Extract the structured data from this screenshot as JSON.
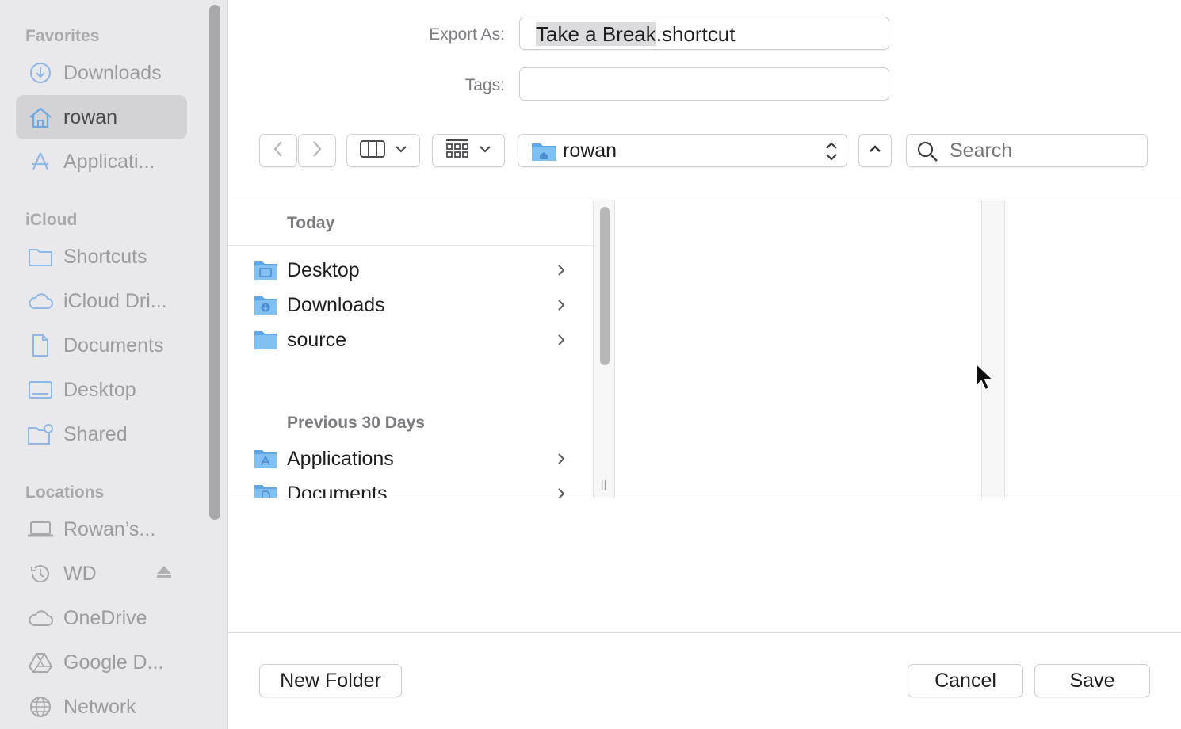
{
  "sidebar": {
    "sections": {
      "favorites": "Favorites",
      "icloud": "iCloud",
      "locations": "Locations"
    },
    "favorites": [
      {
        "label": "Downloads",
        "icon": "download-circle-icon"
      },
      {
        "label": "rowan",
        "icon": "home-icon",
        "selected": true
      },
      {
        "label": "Applicati...",
        "icon": "applications-icon"
      }
    ],
    "icloud": [
      {
        "label": "Shortcuts",
        "icon": "folder-icon"
      },
      {
        "label": "iCloud Dri...",
        "icon": "cloud-icon"
      },
      {
        "label": "Documents",
        "icon": "document-icon"
      },
      {
        "label": "Desktop",
        "icon": "desktop-icon"
      },
      {
        "label": "Shared",
        "icon": "shared-folder-icon"
      }
    ],
    "locations": [
      {
        "label": "Rowan’s...",
        "icon": "laptop-icon"
      },
      {
        "label": "WD",
        "icon": "time-machine-icon",
        "eject": true
      },
      {
        "label": "OneDrive",
        "icon": "cloud-icon"
      },
      {
        "label": "Google D...",
        "icon": "google-drive-icon"
      },
      {
        "label": "Network",
        "icon": "globe-icon"
      }
    ]
  },
  "form": {
    "export_label": "Export As:",
    "filename_base": "Take a Break",
    "filename_ext": ".shortcut",
    "tags_label": "Tags:",
    "tags_value": ""
  },
  "toolbar": {
    "location": "rowan",
    "search_placeholder": "Search"
  },
  "browser": {
    "groups": [
      {
        "title": "Today",
        "items": [
          {
            "name": "Desktop",
            "icon": "desktop-folder-icon"
          },
          {
            "name": "Downloads",
            "icon": "downloads-folder-icon"
          },
          {
            "name": "source",
            "icon": "folder-icon"
          }
        ]
      },
      {
        "title": "Previous 30 Days",
        "items": [
          {
            "name": "Applications",
            "icon": "applications-folder-icon"
          },
          {
            "name": "Documents",
            "icon": "documents-folder-icon"
          }
        ]
      }
    ]
  },
  "buttons": {
    "new_folder": "New Folder",
    "cancel": "Cancel",
    "save": "Save"
  },
  "colors": {
    "sidebar_bg": "#e9e9eb",
    "sidebar_selected": "#d3d3d6",
    "folder_blue": "#6fb2ea",
    "icon_blue": "#6aa8e6"
  }
}
